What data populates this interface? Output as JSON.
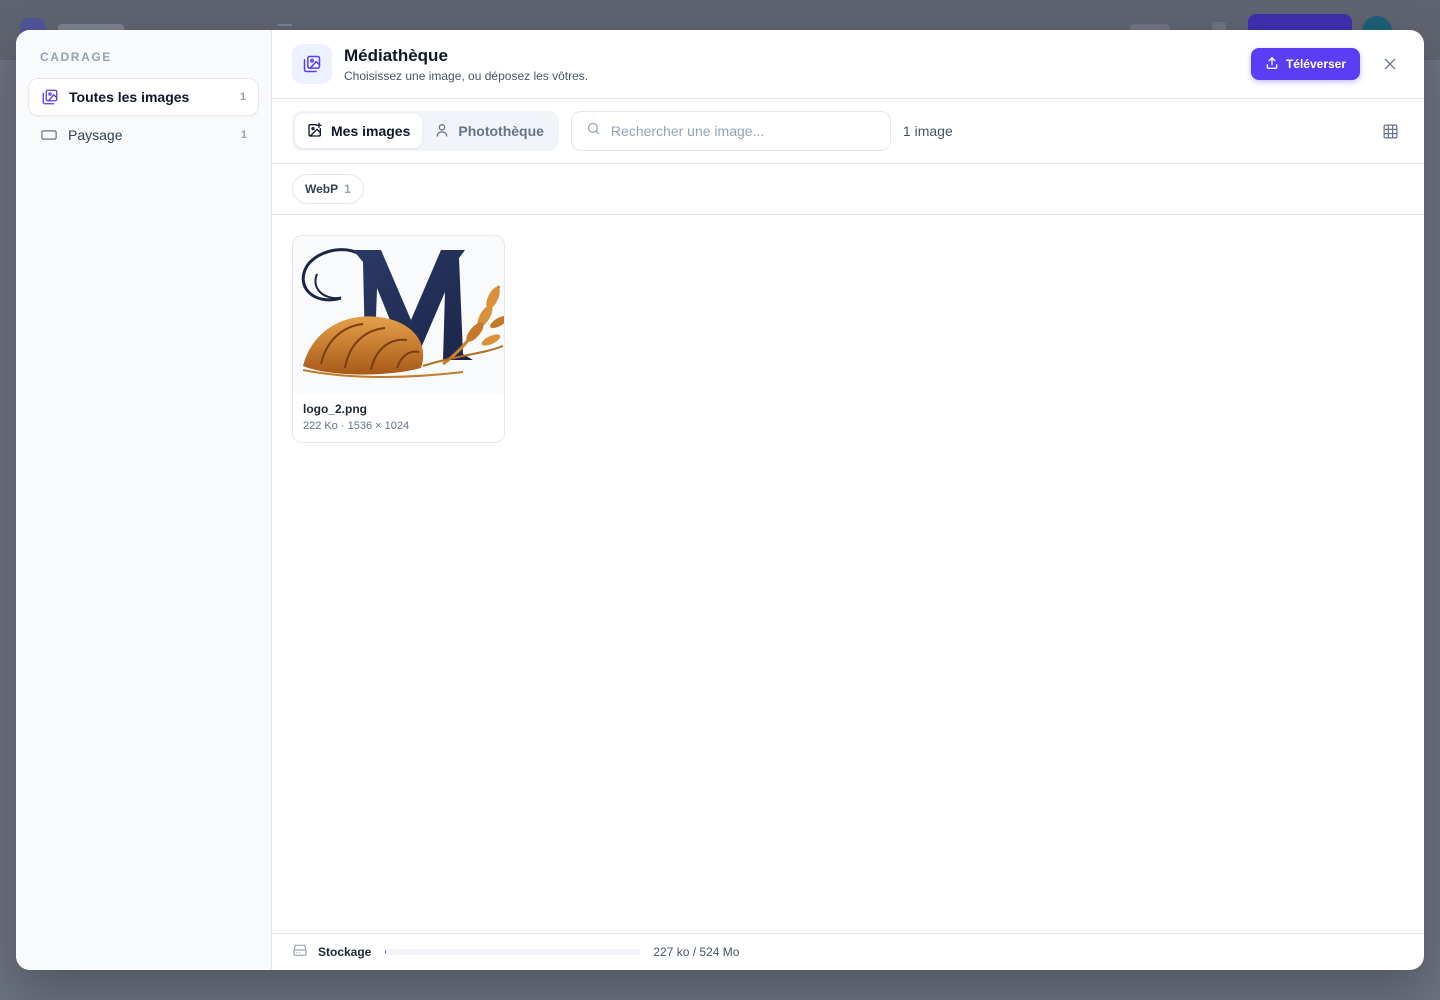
{
  "sidebar": {
    "title": "CADRAGE",
    "items": [
      {
        "label": "Toutes les images",
        "count": "1",
        "icon": "images-icon"
      },
      {
        "label": "Paysage",
        "count": "1",
        "icon": "landscape-rect-icon"
      }
    ]
  },
  "header": {
    "title": "Médiathèque",
    "subtitle": "Choisissez une image, ou déposez les vôtres.",
    "upload_label": "Téléverser"
  },
  "toolbar": {
    "tabs": [
      {
        "label": "Mes images",
        "icon": "image-plus-icon"
      },
      {
        "label": "Photothèque",
        "icon": "user-icon"
      }
    ],
    "search_placeholder": "Rechercher une image...",
    "count_label": "1 image"
  },
  "filters": [
    {
      "label": "WebP",
      "count": "1"
    }
  ],
  "images": [
    {
      "name": "logo_2.png",
      "meta": "222 Ko · 1536 × 1024"
    }
  ],
  "footer": {
    "label": "Stockage",
    "value": "227 ko / 524 Mo",
    "used_fraction": 0.0004
  },
  "colors": {
    "accent": "#5b3df5",
    "sidebar_bg": "#f8fafc",
    "overlay": "#6b7280"
  }
}
